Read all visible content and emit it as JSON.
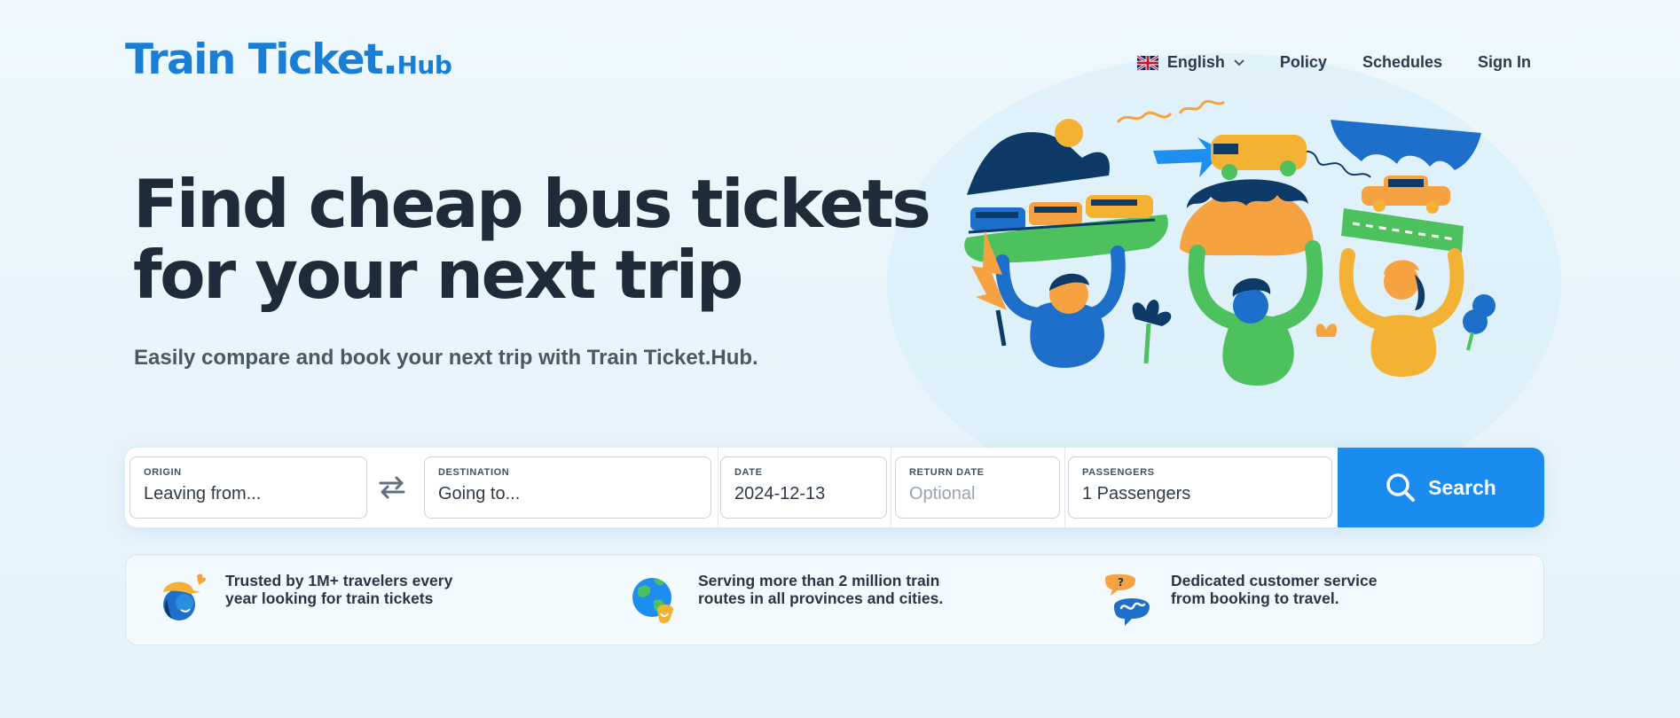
{
  "logo": {
    "main": "Train Ticket",
    "dot": ".",
    "sub": "Hub"
  },
  "nav": {
    "language": "English",
    "items": [
      "Policy",
      "Schedules",
      "Sign In"
    ]
  },
  "hero": {
    "title_line1": "Find cheap bus tickets",
    "title_line2": "for your next trip",
    "subtitle": "Easily compare and book your next trip with Train Ticket.Hub."
  },
  "search": {
    "origin": {
      "label": "ORIGIN",
      "placeholder": "Leaving from..."
    },
    "destination": {
      "label": "DESTINATION",
      "placeholder": "Going to..."
    },
    "date": {
      "label": "DATE",
      "value": "2024-12-13"
    },
    "return_date": {
      "label": "RETURN DATE",
      "placeholder": "Optional"
    },
    "passengers": {
      "label": "PASSENGERS",
      "value": "1 Passengers"
    },
    "button_label": "Search"
  },
  "features": [
    {
      "icon": "traveler-icon",
      "text": "Trusted by 1M+ travelers every\nyear looking for train tickets"
    },
    {
      "icon": "globe-icon",
      "text": "Serving more than 2 million train\nroutes in all provinces and cities."
    },
    {
      "icon": "chat-support-icon",
      "text": "Dedicated customer service\nfrom booking to travel."
    }
  ],
  "colors": {
    "brand": "#1a7fd4",
    "search_button": "#1a8cef",
    "heading": "#1e2b38",
    "background": "#eef8fd"
  }
}
